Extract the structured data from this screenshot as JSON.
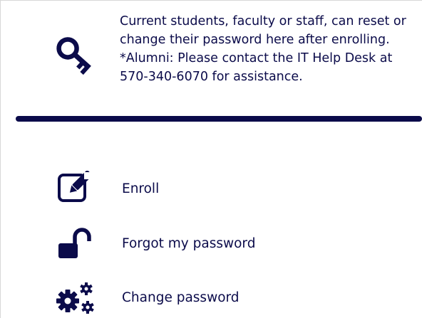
{
  "intro": {
    "text": "Current students, faculty or staff, can reset or change their password here after enrolling. *Alumni: Please contact the IT Help Desk at 570-340-6070 for assistance.",
    "icon": "key-icon"
  },
  "colors": {
    "accent": "#0b0b4a",
    "border": "#d8d8d8"
  },
  "menu": {
    "items": [
      {
        "label": "Enroll",
        "icon": "edit-icon"
      },
      {
        "label": "Forgot my password",
        "icon": "unlock-icon"
      },
      {
        "label": "Change password",
        "icon": "gears-icon"
      }
    ]
  }
}
